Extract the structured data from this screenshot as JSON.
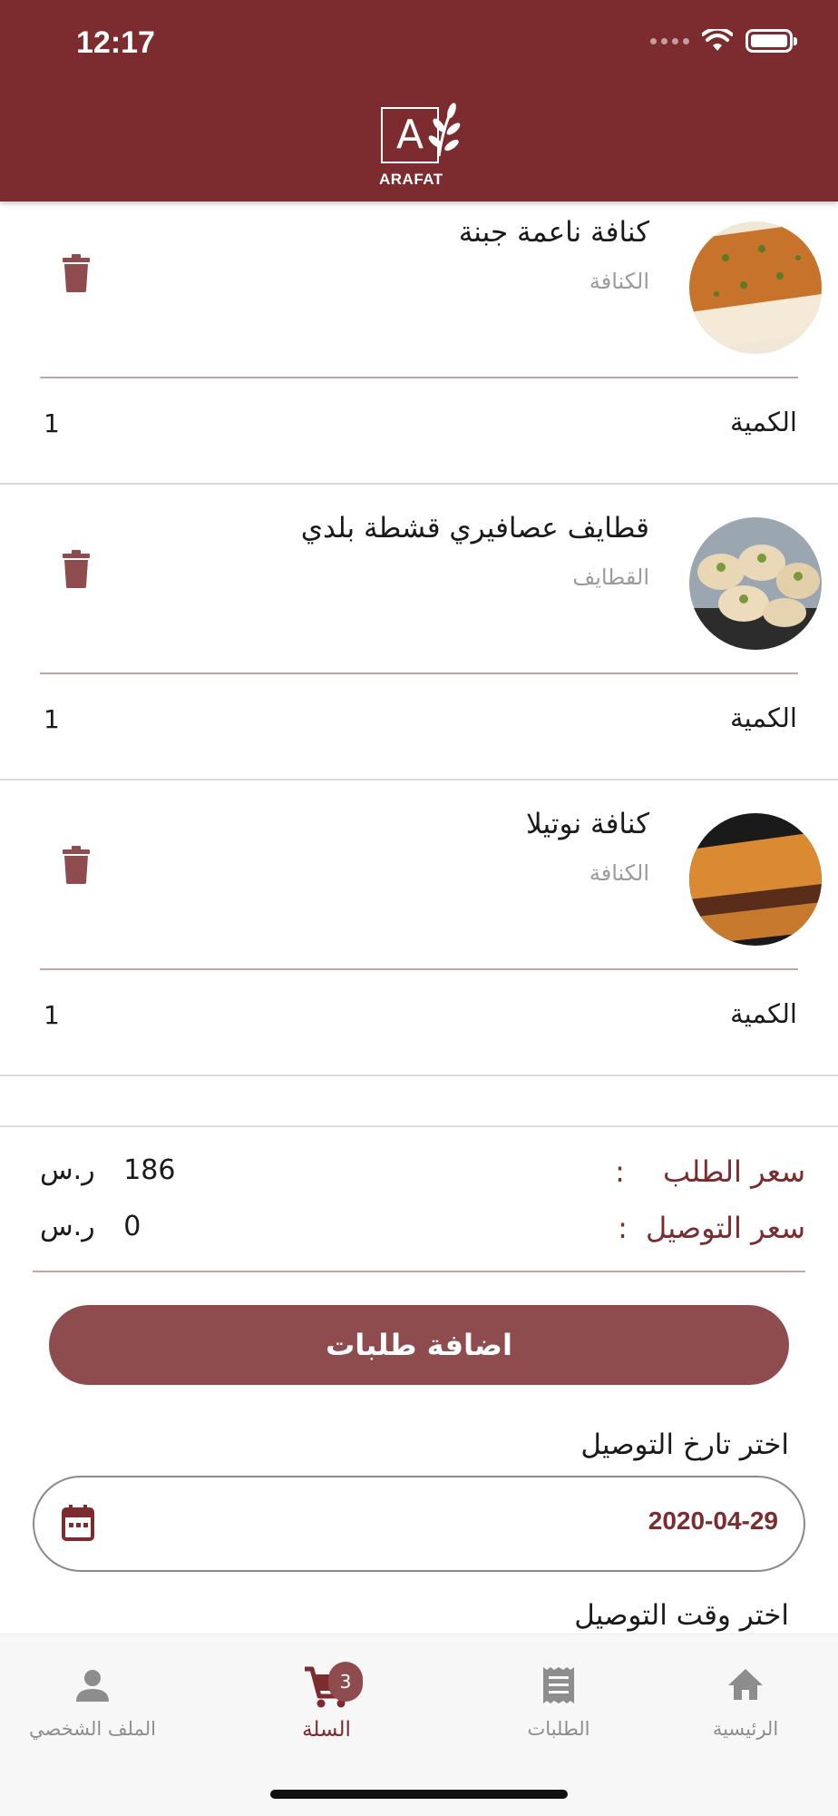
{
  "status_bar": {
    "time": "12:17"
  },
  "header": {
    "logo_letter": "A",
    "logo_text": "ARAFAT"
  },
  "cart_items": [
    {
      "name": "كنافة ناعمة جبنة",
      "category": "الكنافة",
      "quantity_label": "الكمية",
      "quantity": "1",
      "image": "kunafa-cheese-photo"
    },
    {
      "name": "قطايف عصافيري قشطة بلدي",
      "category": "القطايف",
      "quantity_label": "الكمية",
      "quantity": "1",
      "image": "qatayef-photo"
    },
    {
      "name": "كنافة نوتيلا",
      "category": "الكنافة",
      "quantity_label": "الكمية",
      "quantity": "1",
      "image": "kunafa-nutella-photo"
    }
  ],
  "totals": {
    "order_price_label": "سعر الطلب",
    "order_price_colon": ":",
    "order_price_value": "186",
    "delivery_price_label": "سعر التوصيل",
    "delivery_price_colon": ":",
    "delivery_price_value": "0",
    "currency": "ر.س"
  },
  "actions": {
    "add_orders_label": "اضافة طلبات"
  },
  "delivery": {
    "date_label": "اختر تارخ التوصيل",
    "date_value": "2020-04-29",
    "time_label": "اختر وقت التوصيل"
  },
  "tabbar": {
    "home": "الرئيسية",
    "orders": "الطلبات",
    "cart": "السلة",
    "cart_count": "3",
    "profile": "الملف الشخصي"
  },
  "colors": {
    "brand": "#7c2b2e",
    "button": "#8f4c4e",
    "divider": "#c9a2a3"
  },
  "icons": [
    "trash-icon",
    "calendar-icon",
    "home-icon",
    "orders-icon",
    "cart-icon",
    "profile-icon",
    "wifi-icon",
    "battery-icon"
  ]
}
